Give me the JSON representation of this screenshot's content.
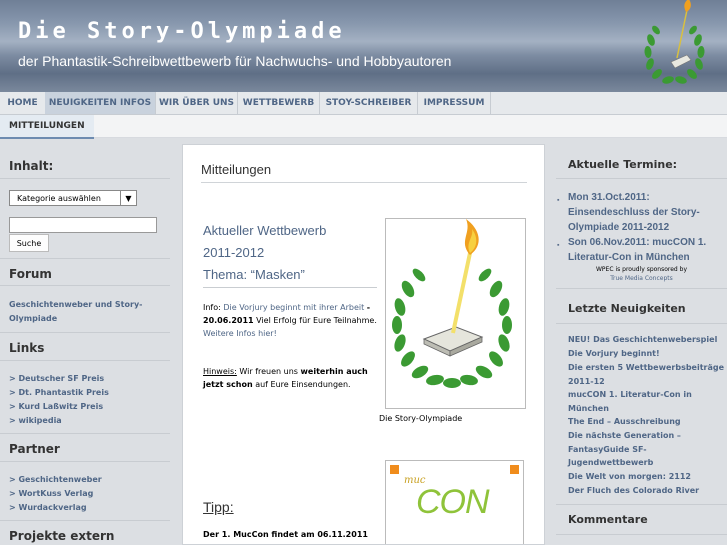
{
  "header": {
    "title": "Die Story-Olympiade",
    "description": "der Phantastik-Schreibwettbewerb für Nachwuchs- und Hobbyautoren"
  },
  "nav": {
    "items": [
      {
        "label": "HOME"
      },
      {
        "label": "NEUIGKEITEN INFOS"
      },
      {
        "label": "WIR ÜBER UNS"
      },
      {
        "label": "WETTBEWERB"
      },
      {
        "label": "STOY-SCHREIBER"
      },
      {
        "label": "IMPRESSUM"
      }
    ],
    "sub": {
      "label": "MITTEILUNGEN"
    }
  },
  "sidebar_left": {
    "inhalt_heading": "Inhalt:",
    "category_select": "Kategorie auswählen",
    "search_button": "Suche",
    "forum_heading": "Forum",
    "forum_link_1": "Geschichtenweber und Story-",
    "forum_link_2": "Olympiade",
    "links_heading": "Links",
    "links": [
      "> Deutscher SF Preis",
      "> Dt. Phantastik Preis",
      "> Kurd Laßwitz Preis",
      "> wikipedia"
    ],
    "partner_heading": "Partner",
    "partners": [
      "> Geschichtenweber",
      "> WortKuss Verlag",
      "> Wurdackverlag"
    ],
    "projekte_heading": "Projekte extern"
  },
  "main": {
    "page_title": "Mitteilungen",
    "post_title_1": "Aktueller Wettbewerb",
    "post_title_2": "2011-2012",
    "post_title_3": "Thema: “Masken”",
    "info_label": "Info:",
    "info_link": "Die Vorjury beginnt mit ihrer Arbeit",
    "info_date": "- 20.06.2011",
    "info_text": "Viel Erfolg für Eure Teilnahme.",
    "info_more": "Weitere Infos hier!",
    "hinweis_label": "Hinweis:",
    "hinweis_text_1": "Wir freuen uns",
    "hinweis_text_2": "weiterhin auch jetzt schon",
    "hinweis_text_3": "auf Eure Einsendungen.",
    "image_caption": "Die Story-Olympiade",
    "tipp_heading": "Tipp:",
    "tipp_text": "Der 1. MucCon findet am 06.11.2011",
    "logo2_text": "CON",
    "logo2_script": "muc"
  },
  "sidebar_right": {
    "termine_heading": "Aktuelle Termine:",
    "events": [
      "Mon 31.Oct.2011: Einsendeschluss der Story-Olympiade 2011-2012",
      "Son 06.Nov.2011: mucCON 1. Literatur-Con in München"
    ],
    "sponsor_1": "WPEC is proudly sponsored by",
    "sponsor_2": "True Media Concepts",
    "neuigkeiten_heading": "Letzte Neuigkeiten",
    "news": [
      "NEU! Das Geschichtenweberspiel",
      "Die Vorjury beginnt!",
      "Die ersten 5 Wettbewerbsbeiträge 2011-12",
      "mucCON 1. Literatur-Con in München",
      "The End – Ausschreibung",
      "Die nächste Generation – FantasyGuide SF-Jugendwettbewerb",
      "Die Welt von morgen: 2112",
      "Der Fluch des Colorado River"
    ],
    "kommentare_heading": "Kommentare"
  },
  "colors": {
    "header_bg": "#7f8ea4",
    "link": "#4f6686",
    "wreath": "#3b9a33",
    "flame": "#f0a020",
    "con_green": "#8fc33a"
  }
}
